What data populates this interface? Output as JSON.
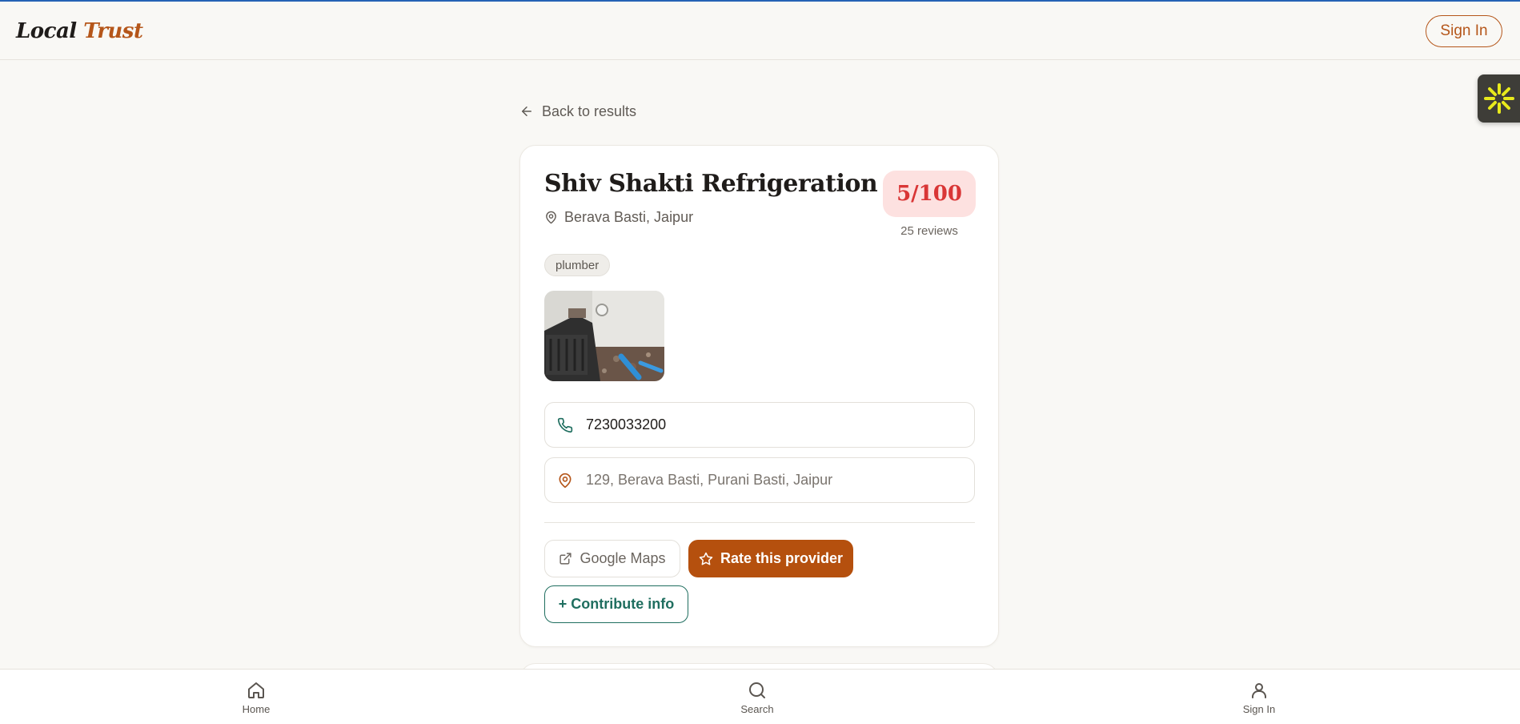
{
  "header": {
    "logo_word1": "Local",
    "logo_word2": "Trust",
    "signin_label": "Sign In"
  },
  "back_label": "Back to results",
  "provider": {
    "name": "Shiv Shakti Refrigeration",
    "locality": "Berava Basti, Jaipur",
    "score": "5/100",
    "reviews": "25 reviews",
    "category": "plumber",
    "phone": "7230033200",
    "address": "129, Berava Basti, Purani Basti, Jaipur"
  },
  "actions": {
    "maps_label": "Google Maps",
    "rate_label": "Rate this provider",
    "contribute_label": "+ Contribute info"
  },
  "bottom_nav": {
    "home": "Home",
    "search": "Search",
    "signin": "Sign In"
  },
  "colors": {
    "brand": "#b5561a",
    "primary_button": "#b5500e",
    "secondary_accent": "#1f6e5f",
    "score_text": "#d93636",
    "score_bg": "#fde1e0",
    "page_bg": "#f9f8f5"
  },
  "icons": {
    "back": "arrow-left-icon",
    "location": "map-pin-icon",
    "phone": "phone-icon",
    "external": "external-link-icon",
    "star": "star-icon",
    "home": "home-icon",
    "search": "search-icon",
    "user": "user-icon",
    "widget": "asterisk-icon"
  }
}
